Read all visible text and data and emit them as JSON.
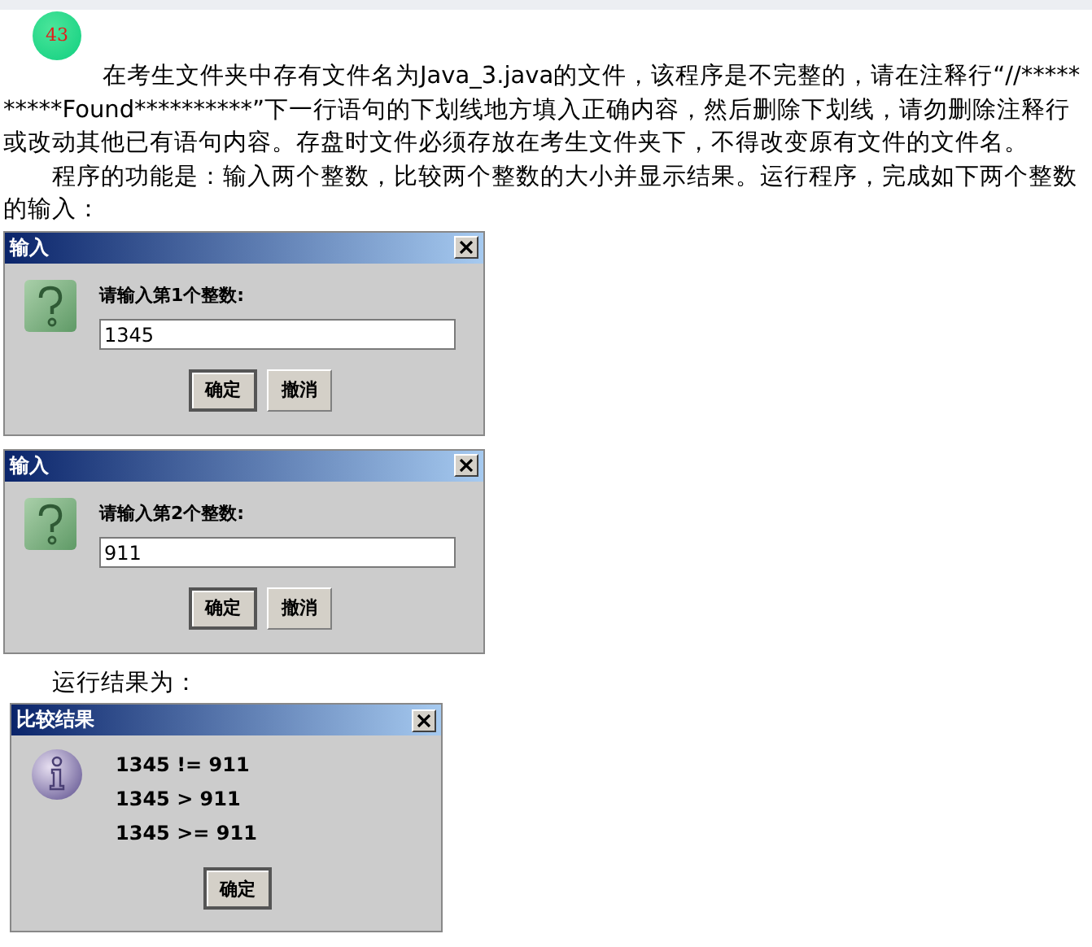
{
  "badge": "43",
  "sections": [
    {
      "kind": "intro",
      "text": "在考生文件夹中存有文件名为Java_3.java的文件，该程序是不完整的，请在注释行“//**********Found**********”下一行语句的下划线地方填入正确内容，然后删除下划线，请勿删除注释行或改动其他已有语句内容。存盘时文件必须存放在考生文件夹下，不得改变原有文件的文件名。"
    },
    {
      "kind": "text",
      "text": "程序的功能是：输入两个整数，比较两个整数的大小并显示结果。运行程序，完成如下两个整数的输入："
    },
    {
      "kind": "input_dialog",
      "title": "输入",
      "prompt": "请输入第1个整数:",
      "value": "1345",
      "buttons": [
        {
          "label": "确定",
          "default": true
        },
        {
          "label": "撤消",
          "default": false
        }
      ]
    },
    {
      "kind": "input_dialog",
      "title": "输入",
      "prompt": "请输入第2个整数:",
      "value": "911",
      "buttons": [
        {
          "label": "确定",
          "default": true
        },
        {
          "label": "撤消",
          "default": false
        }
      ]
    },
    {
      "kind": "text",
      "text": "运行结果为："
    },
    {
      "kind": "message_dialog",
      "title": "比较结果",
      "lines": [
        "1345 != 911",
        "1345 > 911",
        "1345 >= 911"
      ],
      "buttons": [
        {
          "label": "确定",
          "default": true
        }
      ]
    }
  ]
}
